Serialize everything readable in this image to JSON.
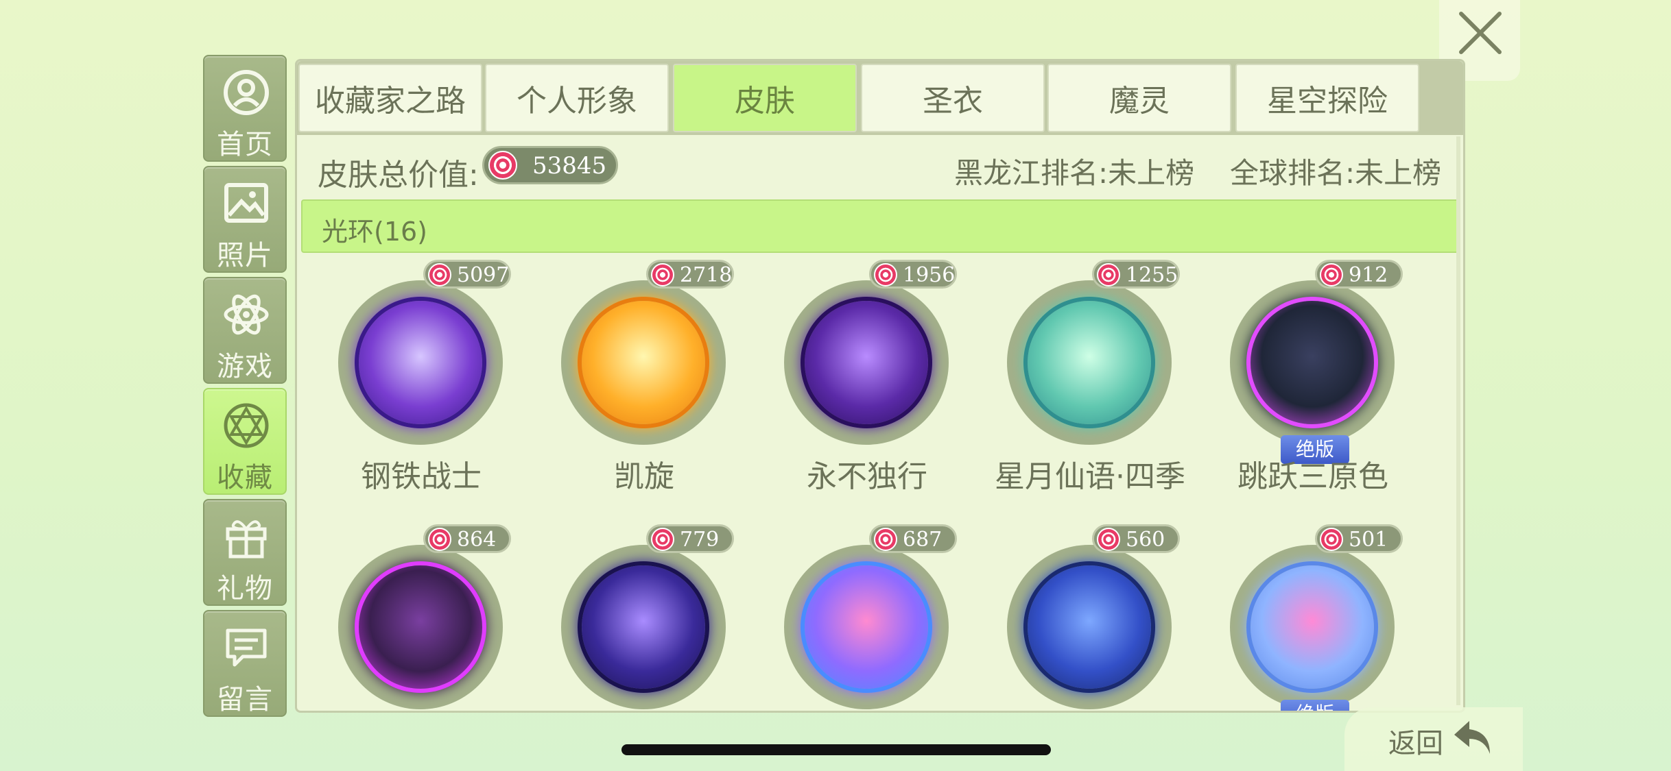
{
  "close": {
    "label": "close"
  },
  "nav": {
    "items": [
      {
        "label": "首页",
        "icon": "home-icon"
      },
      {
        "label": "照片",
        "icon": "photo-icon"
      },
      {
        "label": "游戏",
        "icon": "atom-icon"
      },
      {
        "label": "收藏",
        "icon": "collection-icon",
        "active": true
      },
      {
        "label": "礼物",
        "icon": "gift-icon"
      },
      {
        "label": "留言",
        "icon": "message-icon"
      }
    ]
  },
  "tabs": [
    {
      "label": "收藏家之路"
    },
    {
      "label": "个人形象"
    },
    {
      "label": "皮肤",
      "active": true
    },
    {
      "label": "圣衣"
    },
    {
      "label": "魔灵"
    },
    {
      "label": "星空探险"
    }
  ],
  "info": {
    "total_label": "皮肤总价值:",
    "total_value": "53845",
    "rank_region": "黑龙江排名:未上榜",
    "rank_global": "全球排名:未上榜"
  },
  "section": {
    "title": "光环(16)"
  },
  "items": [
    {
      "name": "钢铁战士",
      "price": "5097",
      "colors": [
        "#d7c6ff",
        "#7a3ed1",
        "#3a1a8a"
      ]
    },
    {
      "name": "凯旋",
      "price": "2718",
      "colors": [
        "#fff7b0",
        "#ffb02a",
        "#e87d10"
      ]
    },
    {
      "name": "永不独行",
      "price": "1956",
      "colors": [
        "#b98cff",
        "#5b2aa8",
        "#2a0f5e"
      ]
    },
    {
      "name": "星月仙语·四季",
      "price": "1255",
      "colors": [
        "#cfffe6",
        "#61c8b0",
        "#2f8f8f"
      ]
    },
    {
      "name": "跳跃三原色",
      "price": "912",
      "colors": [
        "#3a4060",
        "#1f2638",
        "#e24cff"
      ],
      "badge": "绝版"
    },
    {
      "name": "",
      "price": "864",
      "colors": [
        "#7a3fa0",
        "#3a1f50",
        "#e03cff"
      ]
    },
    {
      "name": "",
      "price": "779",
      "colors": [
        "#a98cff",
        "#3a2a9a",
        "#1a1250"
      ]
    },
    {
      "name": "",
      "price": "687",
      "colors": [
        "#ff8ad0",
        "#8f6bff",
        "#4a8cff"
      ]
    },
    {
      "name": "",
      "price": "560",
      "colors": [
        "#7ea8ff",
        "#3350c8",
        "#1a2a70"
      ]
    },
    {
      "name": "",
      "price": "501",
      "colors": [
        "#ff8ad6",
        "#8fb4ff",
        "#5a88e8"
      ],
      "badge": "绝版"
    }
  ],
  "back": {
    "label": "返回"
  }
}
